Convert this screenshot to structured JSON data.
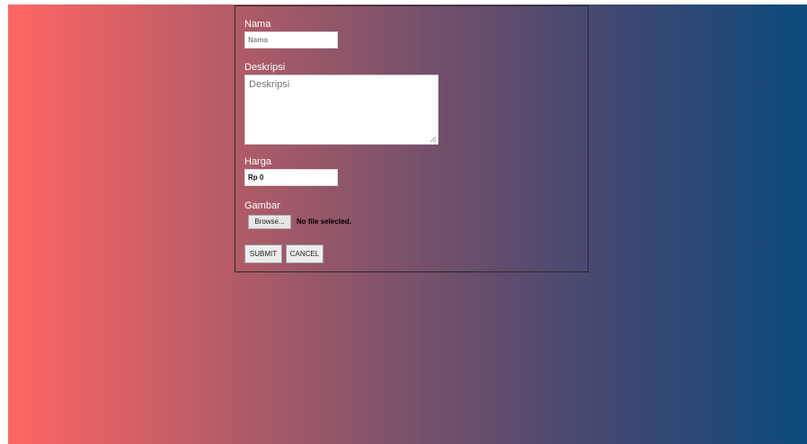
{
  "form": {
    "nama": {
      "label": "Nama",
      "placeholder": "Nama"
    },
    "deskripsi": {
      "label": "Deskripsi",
      "placeholder": "Deskripsi"
    },
    "harga": {
      "label": "Harga",
      "value": "Rp 0"
    },
    "gambar": {
      "label": "Gambar",
      "browse_label": "Browse...",
      "file_status": "No file selected."
    },
    "buttons": {
      "submit": "SUBMIT",
      "cancel": "CANCEL"
    }
  },
  "colors": {
    "gradient_left": "#ff6663",
    "gradient_right": "#0d4b7c",
    "form_border": "#2a2a2a"
  }
}
